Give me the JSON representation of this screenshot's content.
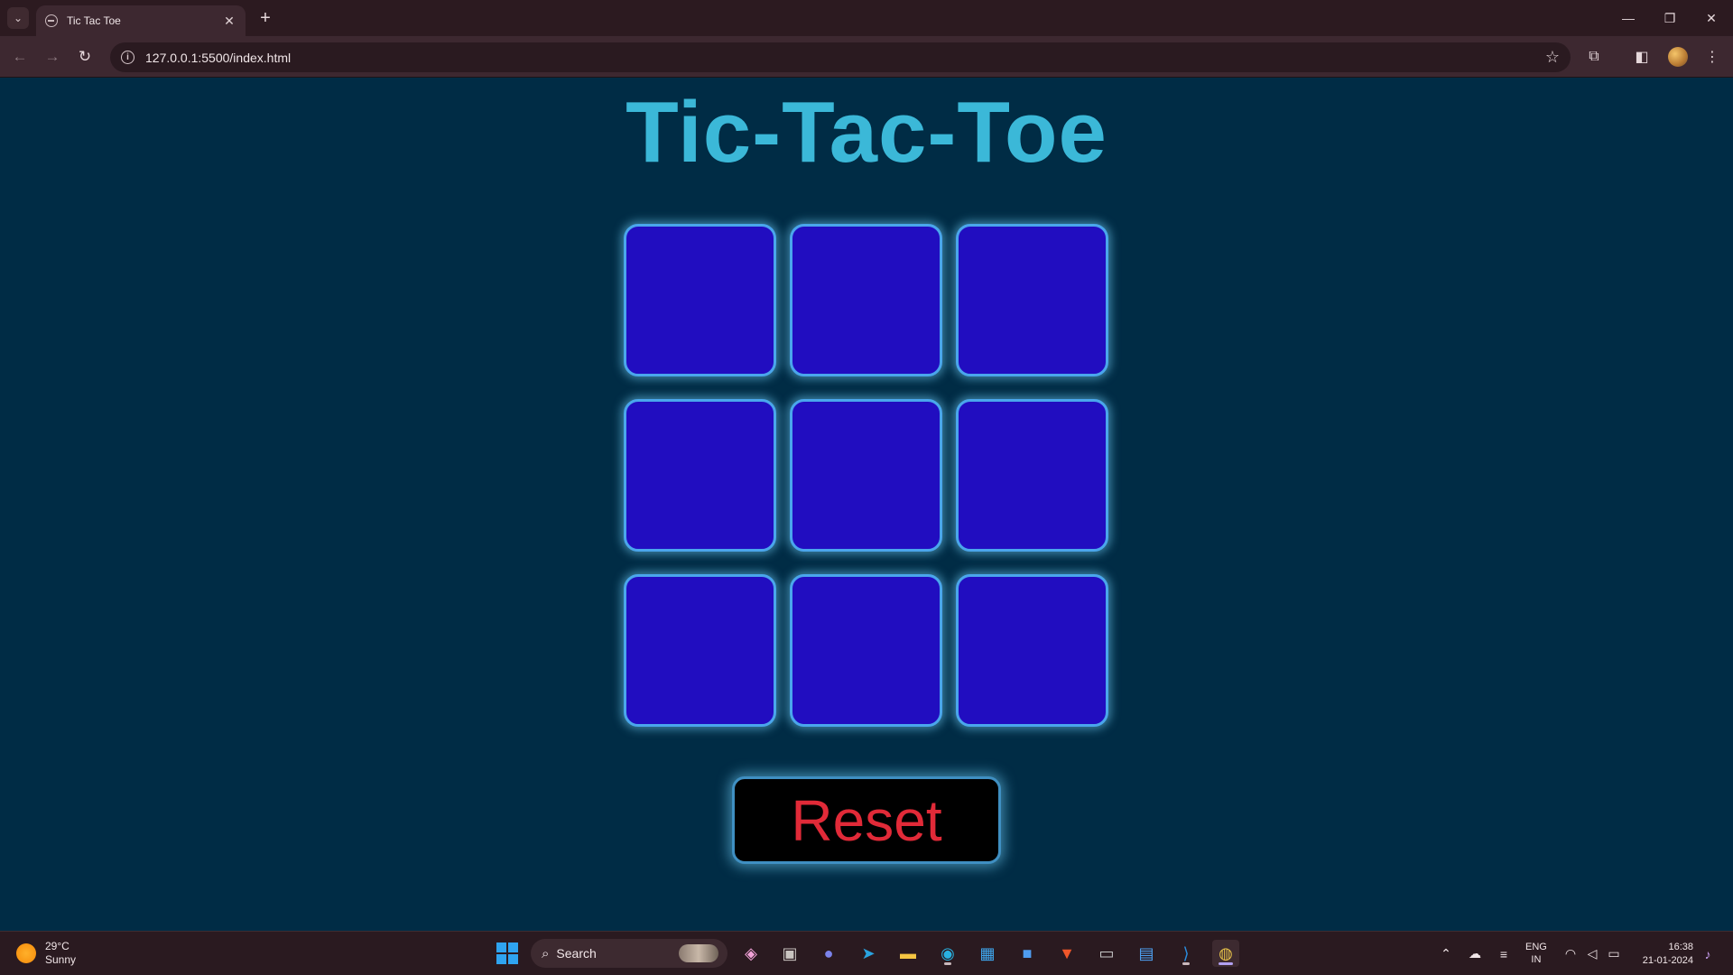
{
  "browser": {
    "tab_title": "Tic Tac Toe",
    "url": "127.0.0.1:5500/index.html",
    "new_tab_symbol": "+",
    "tab_close_symbol": "✕"
  },
  "game": {
    "title": "Tic-Tac-Toe",
    "cells": [
      "",
      "",
      "",
      "",
      "",
      "",
      "",
      "",
      ""
    ],
    "reset_label": "Reset"
  },
  "taskbar": {
    "temperature": "29°C",
    "condition": "Sunny",
    "search_label": "Search",
    "language_line1": "ENG",
    "language_line2": "IN",
    "time": "16:38",
    "date": "21-01-2024"
  },
  "colors": {
    "page_background": "#002c45",
    "title": "#3bb8d8",
    "cell_fill": "#210dc0",
    "cell_border": "#4aa6ec",
    "reset_text": "#e12a38",
    "reset_background": "#000000"
  }
}
